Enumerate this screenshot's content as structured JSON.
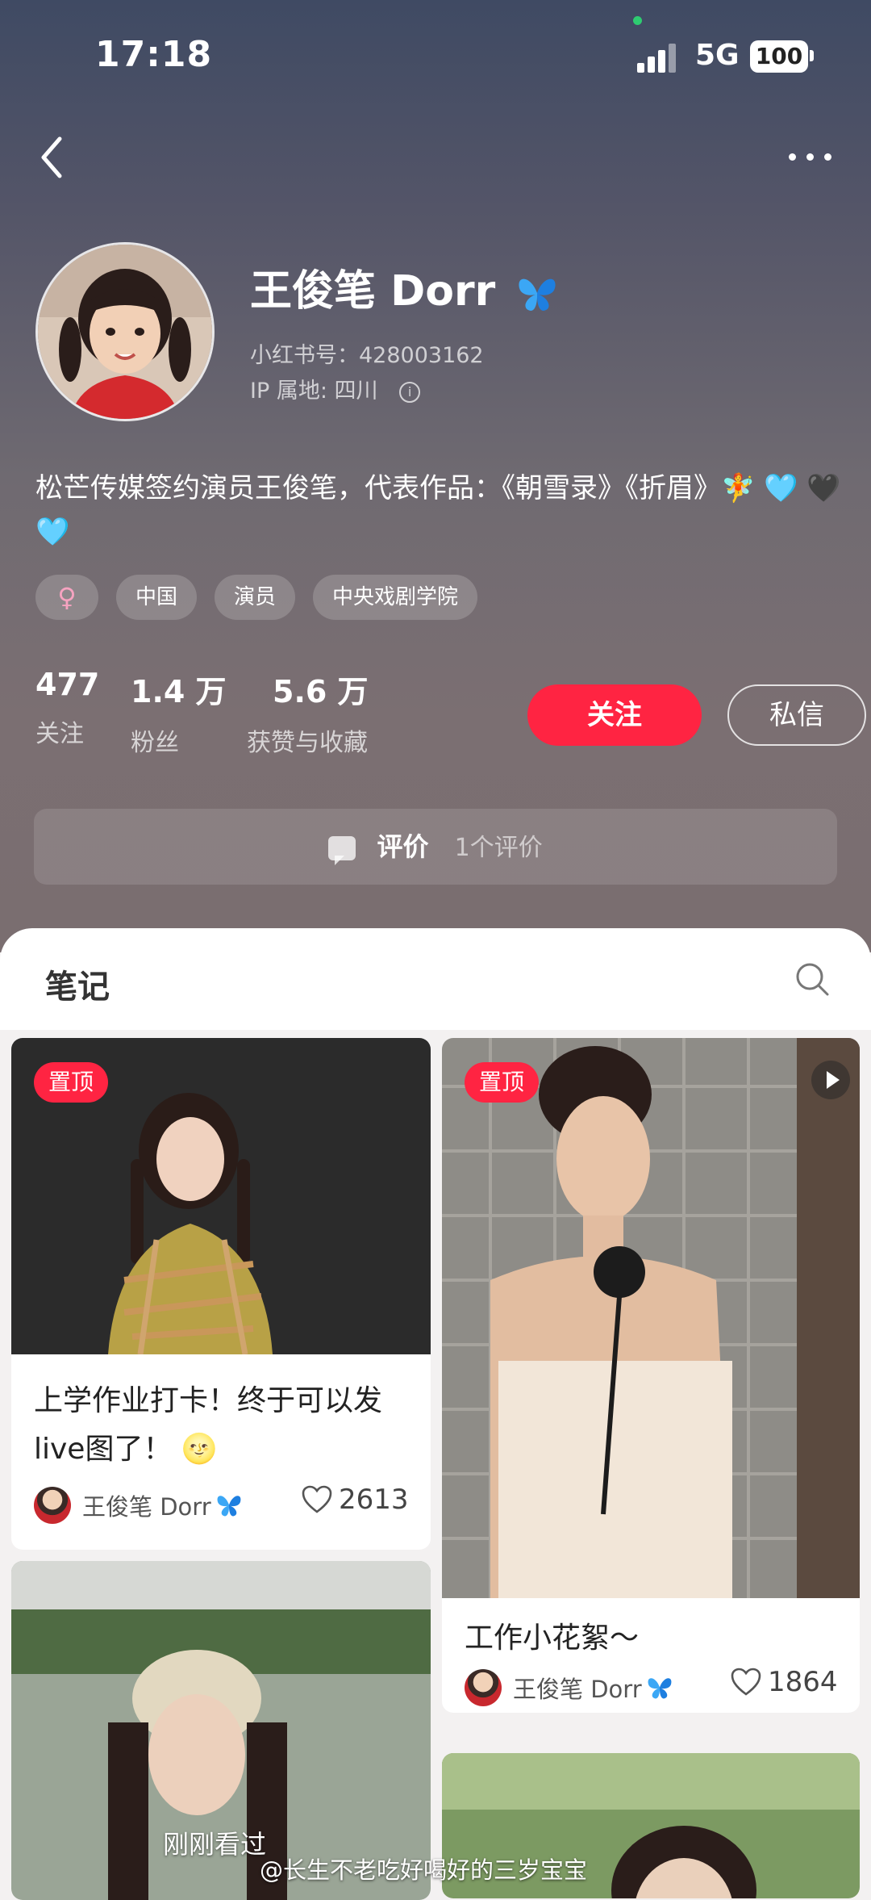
{
  "status_bar": {
    "time": "17:18",
    "network": "5G",
    "battery": "100"
  },
  "profile": {
    "name": "王俊笔 Dorr",
    "red_id": "小红书号：428003162",
    "ip": "IP 属地: 四川",
    "bio": "松芒传媒签约演员王俊笔，代表作品：《朝雪录》《折眉》🧚 🩵 🖤 🩵",
    "tags": [
      "中国",
      "演员",
      "中央戏剧学院"
    ],
    "gender_symbol": "♀"
  },
  "stats": [
    {
      "value": "477",
      "label": "关注"
    },
    {
      "value": "1.4 万",
      "label": "粉丝"
    },
    {
      "value": "5.6 万",
      "label": "获赞与收藏"
    }
  ],
  "buttons": {
    "follow": "关注",
    "message": "私信"
  },
  "review": {
    "title": "评价",
    "count": "1个评价"
  },
  "notes_tab": {
    "title": "笔记"
  },
  "cards": [
    {
      "badge": "置顶",
      "title": "上学作业打卡！终于可以发live图了！ 🌝",
      "author": "王俊笔 Dorr",
      "likes": "2613"
    },
    {
      "badge": "置顶",
      "title": "工作小花絮～",
      "author": "王俊笔 Dorr",
      "likes": "1864"
    }
  ],
  "overlay": {
    "recent": "刚刚看过",
    "watermark": "@长生不老吃好喝好的三岁宝宝"
  },
  "colors": {
    "accent": "#ff2442",
    "header_bg": "#6f6a71"
  },
  "icons": [
    "back-arrow-icon",
    "more-dots-icon",
    "info-icon",
    "review-chat-icon",
    "search-icon",
    "heart-icon",
    "play-icon",
    "butterfly-icon"
  ]
}
